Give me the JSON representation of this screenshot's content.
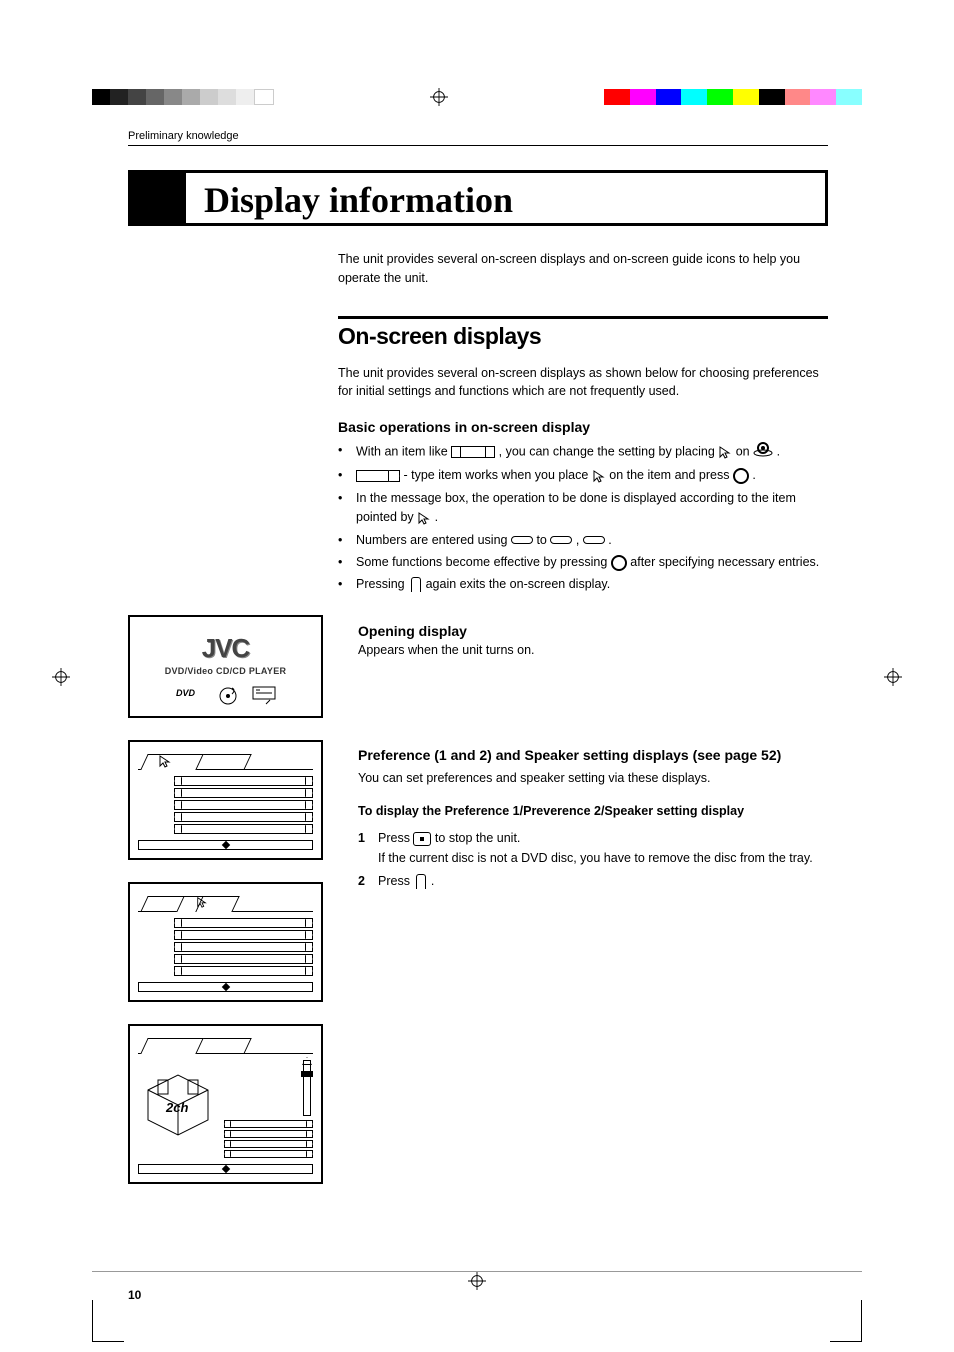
{
  "header": {
    "preliminary": "Preliminary knowledge"
  },
  "title": "Display information",
  "intro": "The unit provides several on-screen displays and on-screen guide icons to help you operate the unit.",
  "section1": {
    "heading": "On-screen displays",
    "text": "The unit provides several on-screen displays as shown below for choosing preferences for initial settings and functions which are not frequently used.",
    "basic_head": "Basic operations in on-screen display",
    "bullets": {
      "b1a": "With an item like ",
      "b1b": " , you can change the setting by placing ",
      "b1c": " on ",
      "b1d": ".",
      "b2a": " - type item works when you place ",
      "b2b": " on the item and press ",
      "b2c": ".",
      "b3a": "In the message box, the operation to be done is displayed according to the item pointed by ",
      "b3b": ".",
      "b4a": "Numbers are entered using ",
      "b4b": " to ",
      "b4c": ", ",
      "b4d": ".",
      "b5a": "Some functions become effective by pressing ",
      "b5b": " after specifying necessary entries.",
      "b6a": "Pressing ",
      "b6b": " again exits the on-screen display."
    }
  },
  "opening": {
    "head": "Opening display",
    "text": "Appears when the unit turns on."
  },
  "jvc": {
    "logo": "JVC",
    "sub": "DVD/Video CD/CD PLAYER"
  },
  "pref": {
    "head": "Preference (1 and 2) and Speaker setting displays (see page 52)",
    "text": "You can set preferences and speaker setting via these displays.",
    "sub": "To display the Preference 1/Preverence 2/Speaker setting display",
    "step1a": "Press ",
    "step1b": " to stop the unit.",
    "step1c": "If the current disc is not a DVD disc, you have to remove the disc from the tray.",
    "step2a": "Press ",
    "step2b": " .",
    "n1": "1",
    "n2": "2"
  },
  "speaker": {
    "label": "2ch"
  },
  "page_number": "10"
}
